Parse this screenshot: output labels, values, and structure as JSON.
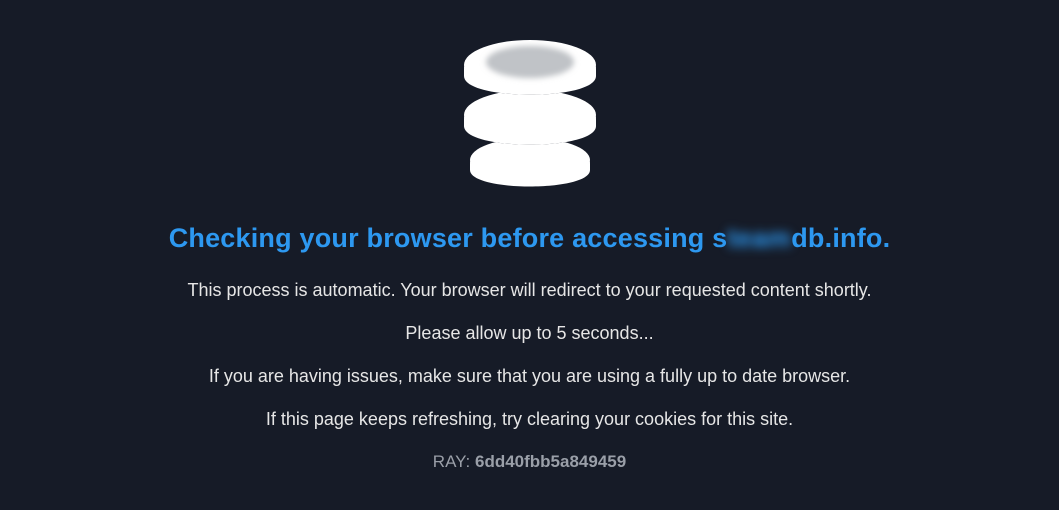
{
  "headline_prefix": "Checking your browser before accessing s",
  "headline_blur": "team",
  "headline_suffix": "db.info.",
  "msg1": "This process is automatic. Your browser will redirect to your requested content shortly.",
  "msg2": "Please allow up to 5 seconds...",
  "msg3": "If you are having issues, make sure that you are using a fully up to date browser.",
  "msg4": "If this page keeps refreshing, try clearing your cookies for this site.",
  "ray_label": "RAY: ",
  "ray_value": "6dd40fbb5a849459"
}
